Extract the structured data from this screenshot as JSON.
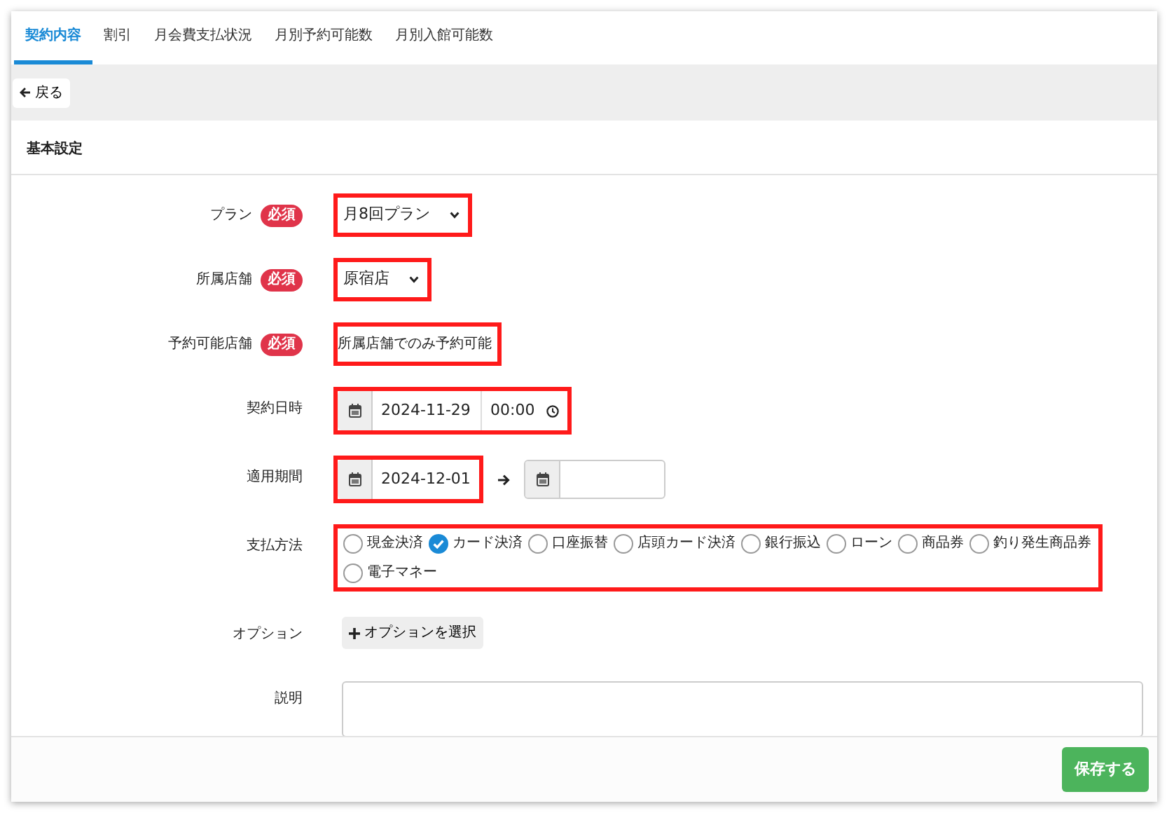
{
  "tabs": [
    {
      "label": "契約内容",
      "selected": true
    },
    {
      "label": "割引",
      "selected": false
    },
    {
      "label": "月会費支払状況",
      "selected": false
    },
    {
      "label": "月別予約可能数",
      "selected": false
    },
    {
      "label": "月別入館可能数",
      "selected": false
    }
  ],
  "back_button": {
    "label": "戻る"
  },
  "section_title": "基本設定",
  "fields": [
    {
      "kind": "select",
      "label": "プラン",
      "required": true,
      "required_label": "必須",
      "value": "月8回プラン",
      "highlighted": true
    },
    {
      "kind": "select",
      "label": "所属店舗",
      "required": true,
      "required_label": "必須",
      "value": "原宿店",
      "highlighted": true
    },
    {
      "kind": "text",
      "label": "予約可能店舗",
      "required": true,
      "required_label": "必須",
      "value": "所属店舗でのみ予約可能",
      "highlighted": true
    },
    {
      "kind": "datetime",
      "label": "契約日時",
      "required": false,
      "date": "2024-11-29",
      "time": "00:00",
      "highlighted": true
    },
    {
      "kind": "daterange",
      "label": "適用期間",
      "required": false,
      "start": "2024-12-01",
      "highlighted": true
    },
    {
      "kind": "radios",
      "label": "支払方法",
      "required": false,
      "highlighted": true,
      "options": [
        {
          "label": "現金決済",
          "selected": false
        },
        {
          "label": "カード決済",
          "selected": true
        },
        {
          "label": "口座振替",
          "selected": false
        },
        {
          "label": "店頭カード決済",
          "selected": false
        },
        {
          "label": "銀行振込",
          "selected": false
        },
        {
          "label": "ローン",
          "selected": false
        },
        {
          "label": "商品券",
          "selected": false
        },
        {
          "label": "釣り発生商品券",
          "selected": false
        },
        {
          "label": "電子マネー",
          "selected": false
        }
      ]
    },
    {
      "kind": "button",
      "label": "オプション",
      "required": false,
      "button": "オプションを選択",
      "highlighted": false
    },
    {
      "kind": "textarea",
      "label": "説明",
      "required": false,
      "highlighted": false
    }
  ],
  "save_button": {
    "label": "保存する"
  }
}
